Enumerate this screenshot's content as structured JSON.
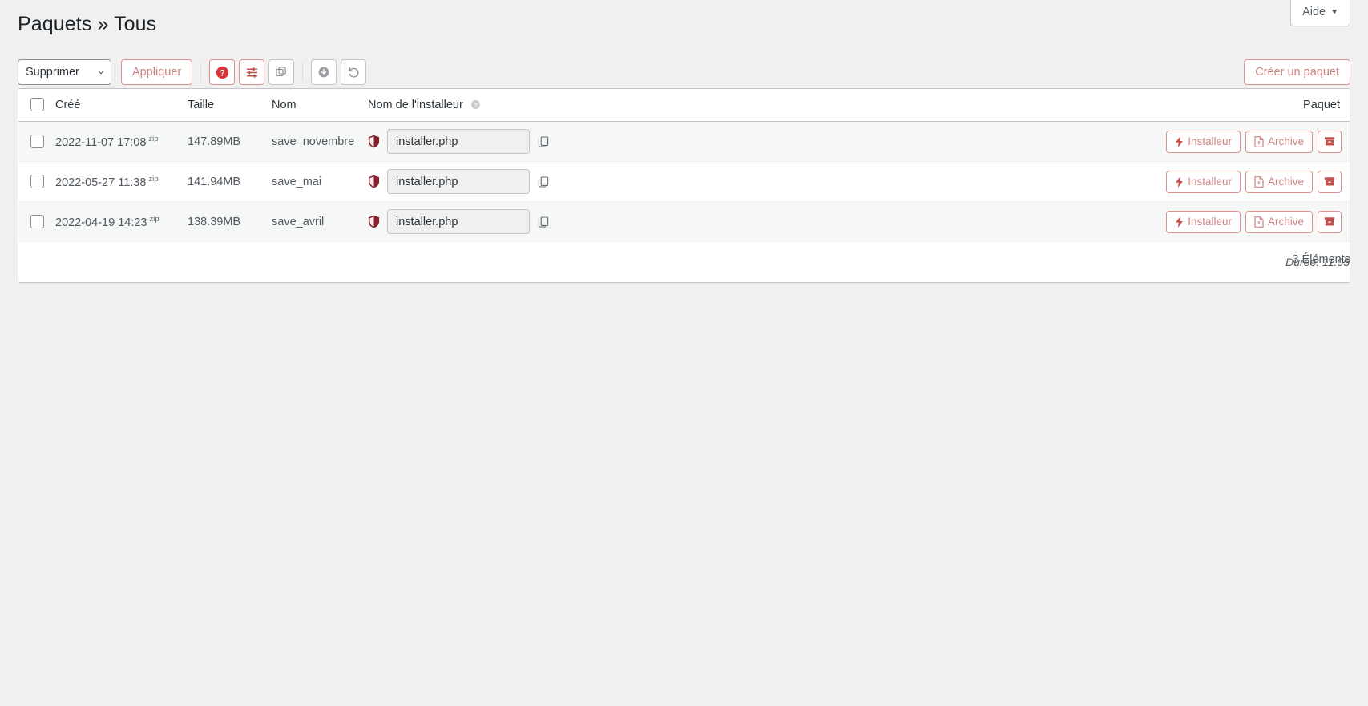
{
  "header": {
    "help_label": "Aide",
    "help_caret": "▼",
    "title": "Paquets » Tous"
  },
  "toolbar": {
    "bulk_action_selected": "Supprimer",
    "bulk_action_options": [
      "Supprimer"
    ],
    "apply_label": "Appliquer",
    "icon_buttons": [
      {
        "name": "help-circle-icon",
        "style": "red"
      },
      {
        "name": "sliders-icon",
        "style": "red"
      },
      {
        "name": "duplicate-icon",
        "style": "gray"
      },
      {
        "name": "download-circle-icon",
        "style": "gray"
      },
      {
        "name": "undo-icon",
        "style": "gray"
      }
    ],
    "create_package_label": "Créer un paquet"
  },
  "table": {
    "columns": {
      "created": "Créé",
      "size": "Taille",
      "name": "Nom",
      "installer_name": "Nom de l'installeur",
      "package": "Paquet"
    },
    "rows": [
      {
        "created": "2022-11-07 17:08",
        "format": "zip",
        "size": "147.89MB",
        "name": "save_novembre",
        "installer_value": "installer.php",
        "installer_label": "Installeur",
        "archive_label": "Archive"
      },
      {
        "created": "2022-05-27 11:38",
        "format": "zip",
        "size": "141.94MB",
        "name": "save_mai",
        "installer_value": "installer.php",
        "installer_label": "Installeur",
        "archive_label": "Archive"
      },
      {
        "created": "2022-04-19 14:23",
        "format": "zip",
        "size": "138.39MB",
        "name": "save_avril",
        "installer_value": "installer.php",
        "installer_label": "Installeur",
        "archive_label": "Archive"
      }
    ],
    "footer_duration": "Durée: 11:05"
  },
  "summary": {
    "items_count": "3 Éléments"
  },
  "colors": {
    "accent_red": "#c9837f",
    "border_red": "#d9938f",
    "shield_dark_red": "#8a1f2a",
    "page_bg": "#f0f0f1",
    "text": "#3c434a"
  }
}
